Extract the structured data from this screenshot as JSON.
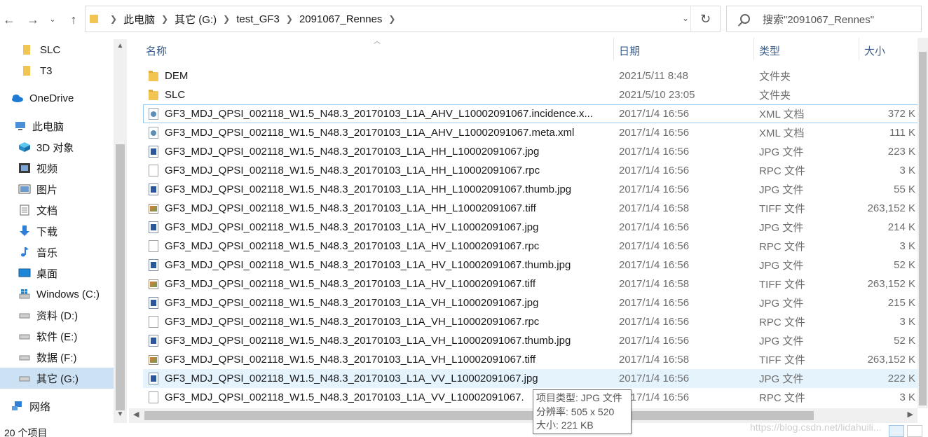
{
  "address": {
    "crumbs": [
      "此电脑",
      "其它 (G:)",
      "test_GF3",
      "2091067_Rennes"
    ]
  },
  "search": {
    "placeholder": "搜索\"2091067_Rennes\""
  },
  "sidebar": {
    "items": [
      {
        "label": "SLC",
        "icon": "folder-icon"
      },
      {
        "label": "T3",
        "icon": "folder-icon"
      },
      {
        "label": "OneDrive",
        "icon": "onedrive-icon"
      },
      {
        "label": "此电脑",
        "icon": "pc-icon"
      },
      {
        "label": "3D 对象",
        "icon": "3d-objects-icon"
      },
      {
        "label": "视频",
        "icon": "video-icon"
      },
      {
        "label": "图片",
        "icon": "pictures-icon"
      },
      {
        "label": "文档",
        "icon": "documents-icon"
      },
      {
        "label": "下载",
        "icon": "download-icon"
      },
      {
        "label": "音乐",
        "icon": "music-icon"
      },
      {
        "label": "桌面",
        "icon": "desktop-icon"
      },
      {
        "label": "Windows (C:)",
        "icon": "windows-drive-icon"
      },
      {
        "label": "资料 (D:)",
        "icon": "drive-icon"
      },
      {
        "label": "软件 (E:)",
        "icon": "drive-icon"
      },
      {
        "label": "数据 (F:)",
        "icon": "drive-icon"
      },
      {
        "label": "其它 (G:)",
        "icon": "drive-icon"
      },
      {
        "label": "网络",
        "icon": "network-icon"
      }
    ]
  },
  "columns": {
    "name": "名称",
    "date": "日期",
    "type": "类型",
    "size": "大小"
  },
  "files": [
    {
      "name": "DEM",
      "date": "2021/5/11 8:48",
      "type": "文件夹",
      "size": "",
      "icon": "folder-icon"
    },
    {
      "name": "SLC",
      "date": "2021/5/10 23:05",
      "type": "文件夹",
      "size": "",
      "icon": "folder-icon"
    },
    {
      "name": "GF3_MDJ_QPSI_002118_W1.5_N48.3_20170103_L1A_AHV_L10002091067.incidence.x...",
      "date": "2017/1/4 16:56",
      "type": "XML 文档",
      "size": "372 K",
      "icon": "xml-file-icon"
    },
    {
      "name": "GF3_MDJ_QPSI_002118_W1.5_N48.3_20170103_L1A_AHV_L10002091067.meta.xml",
      "date": "2017/1/4 16:56",
      "type": "XML 文档",
      "size": "111 K",
      "icon": "xml-file-icon"
    },
    {
      "name": "GF3_MDJ_QPSI_002118_W1.5_N48.3_20170103_L1A_HH_L10002091067.jpg",
      "date": "2017/1/4 16:56",
      "type": "JPG 文件",
      "size": "223 K",
      "icon": "jpg-file-icon"
    },
    {
      "name": "GF3_MDJ_QPSI_002118_W1.5_N48.3_20170103_L1A_HH_L10002091067.rpc",
      "date": "2017/1/4 16:56",
      "type": "RPC 文件",
      "size": "3 K",
      "icon": "rpc-file-icon"
    },
    {
      "name": "GF3_MDJ_QPSI_002118_W1.5_N48.3_20170103_L1A_HH_L10002091067.thumb.jpg",
      "date": "2017/1/4 16:56",
      "type": "JPG 文件",
      "size": "55 K",
      "icon": "jpg-file-icon"
    },
    {
      "name": "GF3_MDJ_QPSI_002118_W1.5_N48.3_20170103_L1A_HH_L10002091067.tiff",
      "date": "2017/1/4 16:58",
      "type": "TIFF 文件",
      "size": "263,152 K",
      "icon": "tiff-file-icon"
    },
    {
      "name": "GF3_MDJ_QPSI_002118_W1.5_N48.3_20170103_L1A_HV_L10002091067.jpg",
      "date": "2017/1/4 16:56",
      "type": "JPG 文件",
      "size": "214 K",
      "icon": "jpg-file-icon"
    },
    {
      "name": "GF3_MDJ_QPSI_002118_W1.5_N48.3_20170103_L1A_HV_L10002091067.rpc",
      "date": "2017/1/4 16:56",
      "type": "RPC 文件",
      "size": "3 K",
      "icon": "rpc-file-icon"
    },
    {
      "name": "GF3_MDJ_QPSI_002118_W1.5_N48.3_20170103_L1A_HV_L10002091067.thumb.jpg",
      "date": "2017/1/4 16:56",
      "type": "JPG 文件",
      "size": "52 K",
      "icon": "jpg-file-icon"
    },
    {
      "name": "GF3_MDJ_QPSI_002118_W1.5_N48.3_20170103_L1A_HV_L10002091067.tiff",
      "date": "2017/1/4 16:58",
      "type": "TIFF 文件",
      "size": "263,152 K",
      "icon": "tiff-file-icon"
    },
    {
      "name": "GF3_MDJ_QPSI_002118_W1.5_N48.3_20170103_L1A_VH_L10002091067.jpg",
      "date": "2017/1/4 16:56",
      "type": "JPG 文件",
      "size": "215 K",
      "icon": "jpg-file-icon"
    },
    {
      "name": "GF3_MDJ_QPSI_002118_W1.5_N48.3_20170103_L1A_VH_L10002091067.rpc",
      "date": "2017/1/4 16:56",
      "type": "RPC 文件",
      "size": "3 K",
      "icon": "rpc-file-icon"
    },
    {
      "name": "GF3_MDJ_QPSI_002118_W1.5_N48.3_20170103_L1A_VH_L10002091067.thumb.jpg",
      "date": "2017/1/4 16:56",
      "type": "JPG 文件",
      "size": "52 K",
      "icon": "jpg-file-icon"
    },
    {
      "name": "GF3_MDJ_QPSI_002118_W1.5_N48.3_20170103_L1A_VH_L10002091067.tiff",
      "date": "2017/1/4 16:58",
      "type": "TIFF 文件",
      "size": "263,152 K",
      "icon": "tiff-file-icon"
    },
    {
      "name": "GF3_MDJ_QPSI_002118_W1.5_N48.3_20170103_L1A_VV_L10002091067.jpg",
      "date": "2017/1/4 16:56",
      "type": "JPG 文件",
      "size": "222 K",
      "icon": "jpg-file-icon"
    },
    {
      "name": "GF3_MDJ_QPSI_002118_W1.5_N48.3_20170103_L1A_VV_L10002091067.",
      "date": "2017/1/4 16:56",
      "type": "RPC 文件",
      "size": "3 K",
      "icon": "rpc-file-icon"
    }
  ],
  "tooltip": {
    "line1": "项目类型: JPG 文件",
    "line2": "分辨率: 505 x 520",
    "line3": "大小: 221 KB"
  },
  "status": {
    "count": "20 个项目",
    "watermark": "https://blog.csdn.net/lidahuili..."
  }
}
